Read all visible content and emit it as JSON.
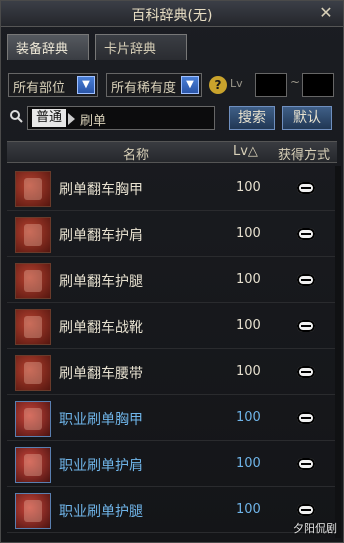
{
  "window": {
    "title": "百科辞典(无)"
  },
  "tabs": [
    {
      "label": "装备辞典",
      "active": true
    },
    {
      "label": "卡片辞典",
      "active": false
    }
  ],
  "filters": {
    "slot": {
      "selected": "所有部位"
    },
    "rarity": {
      "selected": "所有稀有度"
    },
    "level_label": "Lv",
    "level_min": "",
    "level_max": "",
    "tilde": "~"
  },
  "search": {
    "mode": "普通",
    "query": "刷单",
    "search_button": "搜索",
    "default_button": "默认"
  },
  "table": {
    "headers": {
      "name": "名称",
      "level": "Lv△",
      "source": "获得方式"
    },
    "rows": [
      {
        "name": "刷单翻车胸甲",
        "level": "100",
        "rarity_color": "#e6e0cf"
      },
      {
        "name": "刷单翻车护肩",
        "level": "100",
        "rarity_color": "#e6e0cf"
      },
      {
        "name": "刷单翻车护腿",
        "level": "100",
        "rarity_color": "#e6e0cf"
      },
      {
        "name": "刷单翻车战靴",
        "level": "100",
        "rarity_color": "#e6e0cf"
      },
      {
        "name": "刷单翻车腰带",
        "level": "100",
        "rarity_color": "#e6e0cf"
      },
      {
        "name": "职业刷单胸甲",
        "level": "100",
        "rarity_color": "#6fb4e8"
      },
      {
        "name": "职业刷单护肩",
        "level": "100",
        "rarity_color": "#6fb4e8"
      },
      {
        "name": "职业刷单护腿",
        "level": "100",
        "rarity_color": "#6fb4e8"
      }
    ]
  },
  "watermark": "夕阳侃剧"
}
